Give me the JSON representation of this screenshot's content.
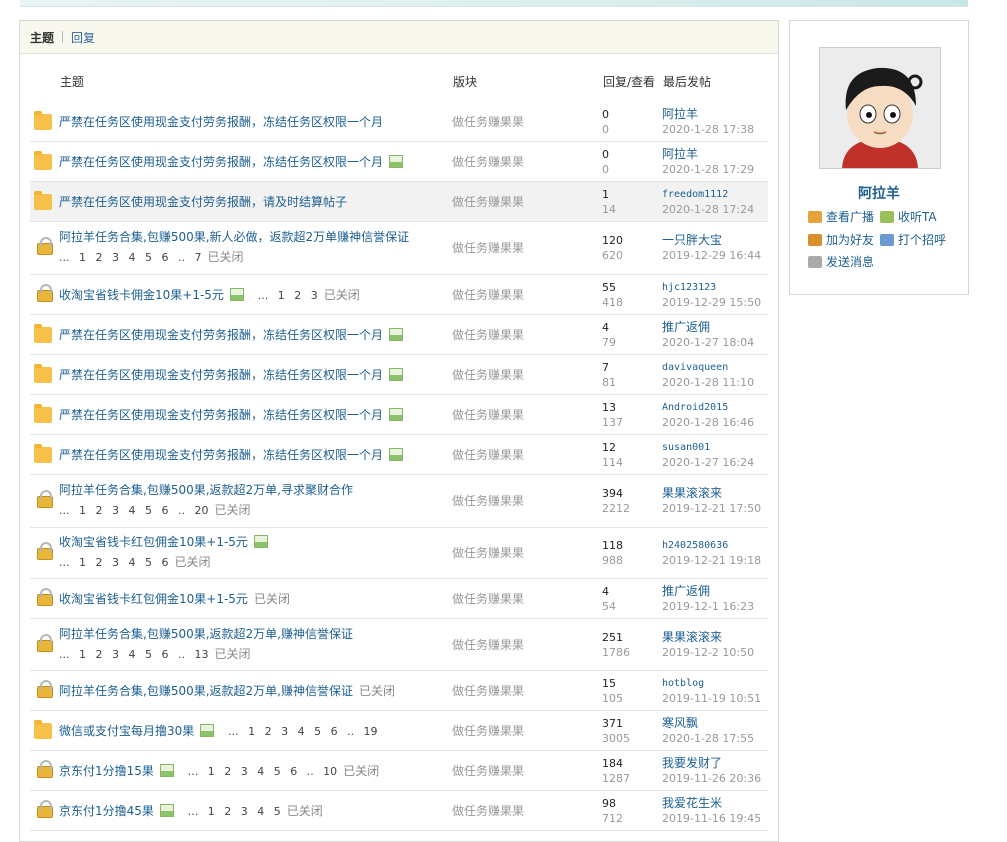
{
  "tabs": {
    "topic": "主题",
    "reply": "回复"
  },
  "headers": {
    "topic": "主题",
    "board": "版块",
    "replies_views": "回复/查看",
    "last_post": "最后发帖"
  },
  "topics": [
    {
      "icon": "folder-icon",
      "title": "严禁在任务区使用现金支付劳务报酬，冻结任务区权限一个月",
      "image": false,
      "pages": "",
      "closed": "",
      "board": "做任务赚果果",
      "replies": "0",
      "views": "0",
      "last_user": "阿拉羊",
      "last_time": "2020-1-28 17:38",
      "mono": false
    },
    {
      "icon": "folder-icon",
      "title": "严禁在任务区使用现金支付劳务报酬，冻结任务区权限一个月",
      "image": true,
      "pages": "",
      "closed": "",
      "board": "做任务赚果果",
      "replies": "0",
      "views": "0",
      "last_user": "阿拉羊",
      "last_time": "2020-1-28 17:29",
      "mono": false
    },
    {
      "icon": "folder-icon",
      "title": "严禁在任务区使用现金支付劳务报酬，请及时结算帖子",
      "image": false,
      "pages": "",
      "closed": "",
      "board": "做任务赚果果",
      "replies": "1",
      "views": "14",
      "last_user": "freedom1112",
      "last_time": "2020-1-28 17:24",
      "mono": true
    },
    {
      "icon": "lock-icon",
      "title": "阿拉羊任务合集,包赚500果,新人必做，返款超2万单赚神信誉保证",
      "image": false,
      "pages": "... 1 2 3 4 5 6 .. 7",
      "closed": "已关闭",
      "board": "做任务赚果果",
      "replies": "120",
      "views": "620",
      "last_user": "一只胖大宝",
      "last_time": "2019-12-29 16:44",
      "mono": false
    },
    {
      "icon": "lock-icon",
      "title": "收淘宝省钱卡佣金10果+1-5元",
      "image": true,
      "pages": "... 1 2 3",
      "closed": "已关闭",
      "board": "做任务赚果果",
      "replies": "55",
      "views": "418",
      "last_user": "hjc123123",
      "last_time": "2019-12-29 15:50",
      "mono": true
    },
    {
      "icon": "folder-icon",
      "title": "严禁在任务区使用现金支付劳务报酬，冻结任务区权限一个月",
      "image": true,
      "pages": "",
      "closed": "",
      "board": "做任务赚果果",
      "replies": "4",
      "views": "79",
      "last_user": "推广返佣",
      "last_time": "2020-1-27 18:04",
      "mono": false
    },
    {
      "icon": "folder-icon",
      "title": "严禁在任务区使用现金支付劳务报酬，冻结任务区权限一个月",
      "image": true,
      "pages": "",
      "closed": "",
      "board": "做任务赚果果",
      "replies": "7",
      "views": "81",
      "last_user": "davivaqueen",
      "last_time": "2020-1-28 11:10",
      "mono": true
    },
    {
      "icon": "folder-icon",
      "title": "严禁在任务区使用现金支付劳务报酬，冻结任务区权限一个月",
      "image": true,
      "pages": "",
      "closed": "",
      "board": "做任务赚果果",
      "replies": "13",
      "views": "137",
      "last_user": "Android2015",
      "last_time": "2020-1-28 16:46",
      "mono": true
    },
    {
      "icon": "folder-icon",
      "title": "严禁在任务区使用现金支付劳务报酬，冻结任务区权限一个月",
      "image": true,
      "pages": "",
      "closed": "",
      "board": "做任务赚果果",
      "replies": "12",
      "views": "114",
      "last_user": "susan001",
      "last_time": "2020-1-27 16:24",
      "mono": true
    },
    {
      "icon": "lock-icon",
      "title": "阿拉羊任务合集,包赚500果,返款超2万单,寻求聚财合作",
      "image": false,
      "pages": "... 1 2 3 4 5 6 .. 20",
      "closed": "已关闭",
      "board": "做任务赚果果",
      "replies": "394",
      "views": "2212",
      "last_user": "果果滚滚来",
      "last_time": "2019-12-21 17:50",
      "mono": false
    },
    {
      "icon": "lock-icon",
      "title": "收淘宝省钱卡红包佣金10果+1-5元",
      "image": true,
      "pages": "... 1 2 3 4 5 6",
      "closed": "已关闭",
      "board": "做任务赚果果",
      "replies": "118",
      "views": "988",
      "last_user": "h2402580636",
      "last_time": "2019-12-21 19:18",
      "mono": true
    },
    {
      "icon": "lock-icon",
      "title": "收淘宝省钱卡红包佣金10果+1-5元",
      "image": false,
      "pages": "",
      "closed": "已关闭",
      "board": "做任务赚果果",
      "replies": "4",
      "views": "54",
      "last_user": "推广返佣",
      "last_time": "2019-12-1 16:23",
      "mono": false
    },
    {
      "icon": "lock-icon",
      "title": "阿拉羊任务合集,包赚500果,返款超2万单,赚神信誉保证",
      "image": false,
      "pages": "... 1 2 3 4 5 6 .. 13",
      "closed": "已关闭",
      "board": "做任务赚果果",
      "replies": "251",
      "views": "1786",
      "last_user": "果果滚滚来",
      "last_time": "2019-12-2 10:50",
      "mono": false
    },
    {
      "icon": "lock-icon",
      "title": "阿拉羊任务合集,包赚500果,返款超2万单,赚神信誉保证",
      "image": false,
      "pages": "",
      "closed": "已关闭",
      "board": "做任务赚果果",
      "replies": "15",
      "views": "105",
      "last_user": "hotblog",
      "last_time": "2019-11-19 10:51",
      "mono": true
    },
    {
      "icon": "folder-icon",
      "title": "微信或支付宝每月撸30果",
      "image": true,
      "pages": "... 1 2 3 4 5 6 .. 19",
      "closed": "",
      "board": "做任务赚果果",
      "replies": "371",
      "views": "3005",
      "last_user": "寒风飘",
      "last_time": "2020-1-28 17:55",
      "mono": false
    },
    {
      "icon": "lock-icon",
      "title": "京东付1分撸15果",
      "image": true,
      "pages": "... 1 2 3 4 5 6 .. 10",
      "closed": "已关闭",
      "board": "做任务赚果果",
      "replies": "184",
      "views": "1287",
      "last_user": "我要发财了",
      "last_time": "2019-11-26 20:36",
      "mono": false
    },
    {
      "icon": "lock-icon",
      "title": "京东付1分撸45果",
      "image": true,
      "pages": "... 1 2 3 4 5",
      "closed": "已关闭",
      "board": "做任务赚果果",
      "replies": "98",
      "views": "712",
      "last_user": "我爱花生米",
      "last_time": "2019-11-16 19:45",
      "mono": false
    }
  ],
  "profile": {
    "name": "阿拉羊",
    "actions": [
      {
        "label": "查看广播",
        "icon": "broadcast-icon",
        "color": "#e6a23c"
      },
      {
        "label": "收听TA",
        "icon": "listen-icon",
        "color": "#9bbf5a"
      },
      {
        "label": "加为好友",
        "icon": "add-friend-icon",
        "color": "#d9902f"
      },
      {
        "label": "打个招呼",
        "icon": "greet-icon",
        "color": "#6b9bd1"
      },
      {
        "label": "发送消息",
        "icon": "message-icon",
        "color": "#aaaaaa"
      }
    ]
  }
}
